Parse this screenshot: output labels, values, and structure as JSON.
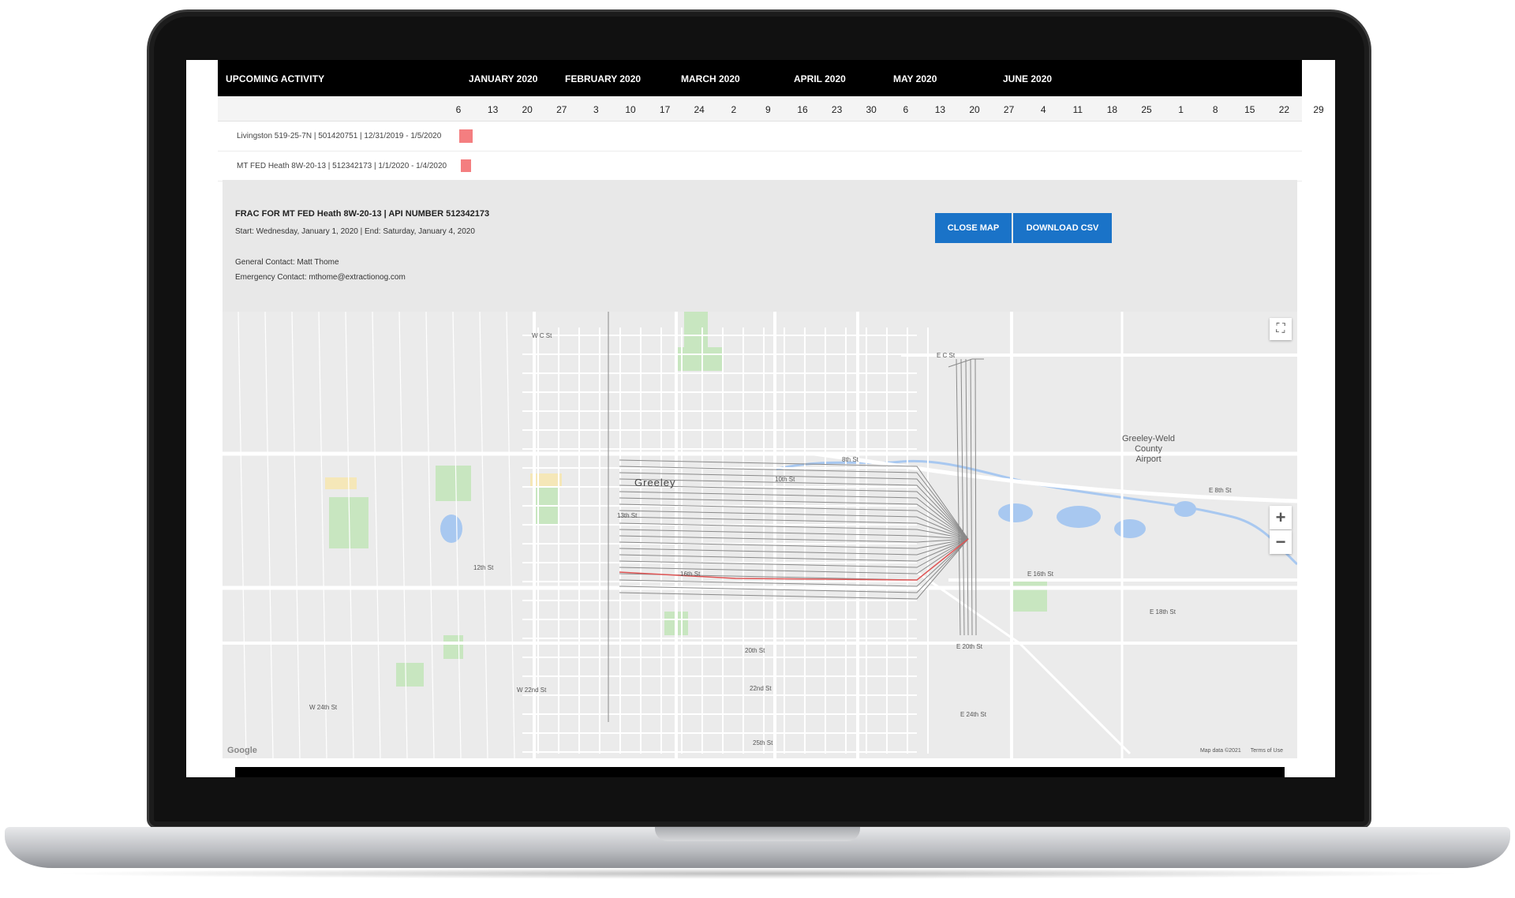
{
  "timeline": {
    "title": "UPCOMING ACTIVITY",
    "months": [
      "JANUARY 2020",
      "FEBRUARY 2020",
      "MARCH 2020",
      "APRIL 2020",
      "MAY 2020",
      "JUNE 2020"
    ],
    "days": [
      "6",
      "13",
      "20",
      "27",
      "3",
      "10",
      "17",
      "24",
      "2",
      "9",
      "16",
      "23",
      "30",
      "6",
      "13",
      "20",
      "27",
      "4",
      "11",
      "18",
      "25",
      "1",
      "8",
      "15",
      "22",
      "29"
    ],
    "rows": [
      {
        "label": "Livingston 519-25-7N | 501420751 | 12/31/2019 - 1/5/2020",
        "start_day_index": 0
      },
      {
        "label": "MT FED Heath 8W-20-13 | 512342173 | 1/1/2020 - 1/4/2020",
        "start_day_index": 0
      }
    ],
    "bar_color": "#f47e80"
  },
  "panel": {
    "title": "FRAC FOR MT FED Heath 8W-20-13 | API NUMBER 512342173",
    "dates": "Start: Wednesday, January 1, 2020 | End: Saturday, January 4, 2020",
    "general_contact": "General Contact: Matt Thome",
    "emergency_contact": "Emergency Contact: mthome@extractionog.com",
    "close_map_label": "CLOSE MAP",
    "download_csv_label": "DOWNLOAD CSV",
    "accent_color": "#1a73c8"
  },
  "map": {
    "city": "Greeley",
    "airport": [
      "Greeley-Weld",
      "County",
      "Airport"
    ],
    "streets": [
      "W C St",
      "E C St",
      "8th St",
      "10th St",
      "13th St",
      "16th St",
      "E 16th St",
      "E 18th St",
      "E 20th St",
      "20th St",
      "W 22nd St",
      "22nd St",
      "W 24th St",
      "E 24th St",
      "25th St",
      "E 8th St",
      "12th St"
    ],
    "attribution": "Map data ©2021",
    "terms": "Terms of Use",
    "google": "Google",
    "fullscreen_icon": "fullscreen-icon",
    "zoom_in": "+",
    "zoom_out": "−"
  }
}
